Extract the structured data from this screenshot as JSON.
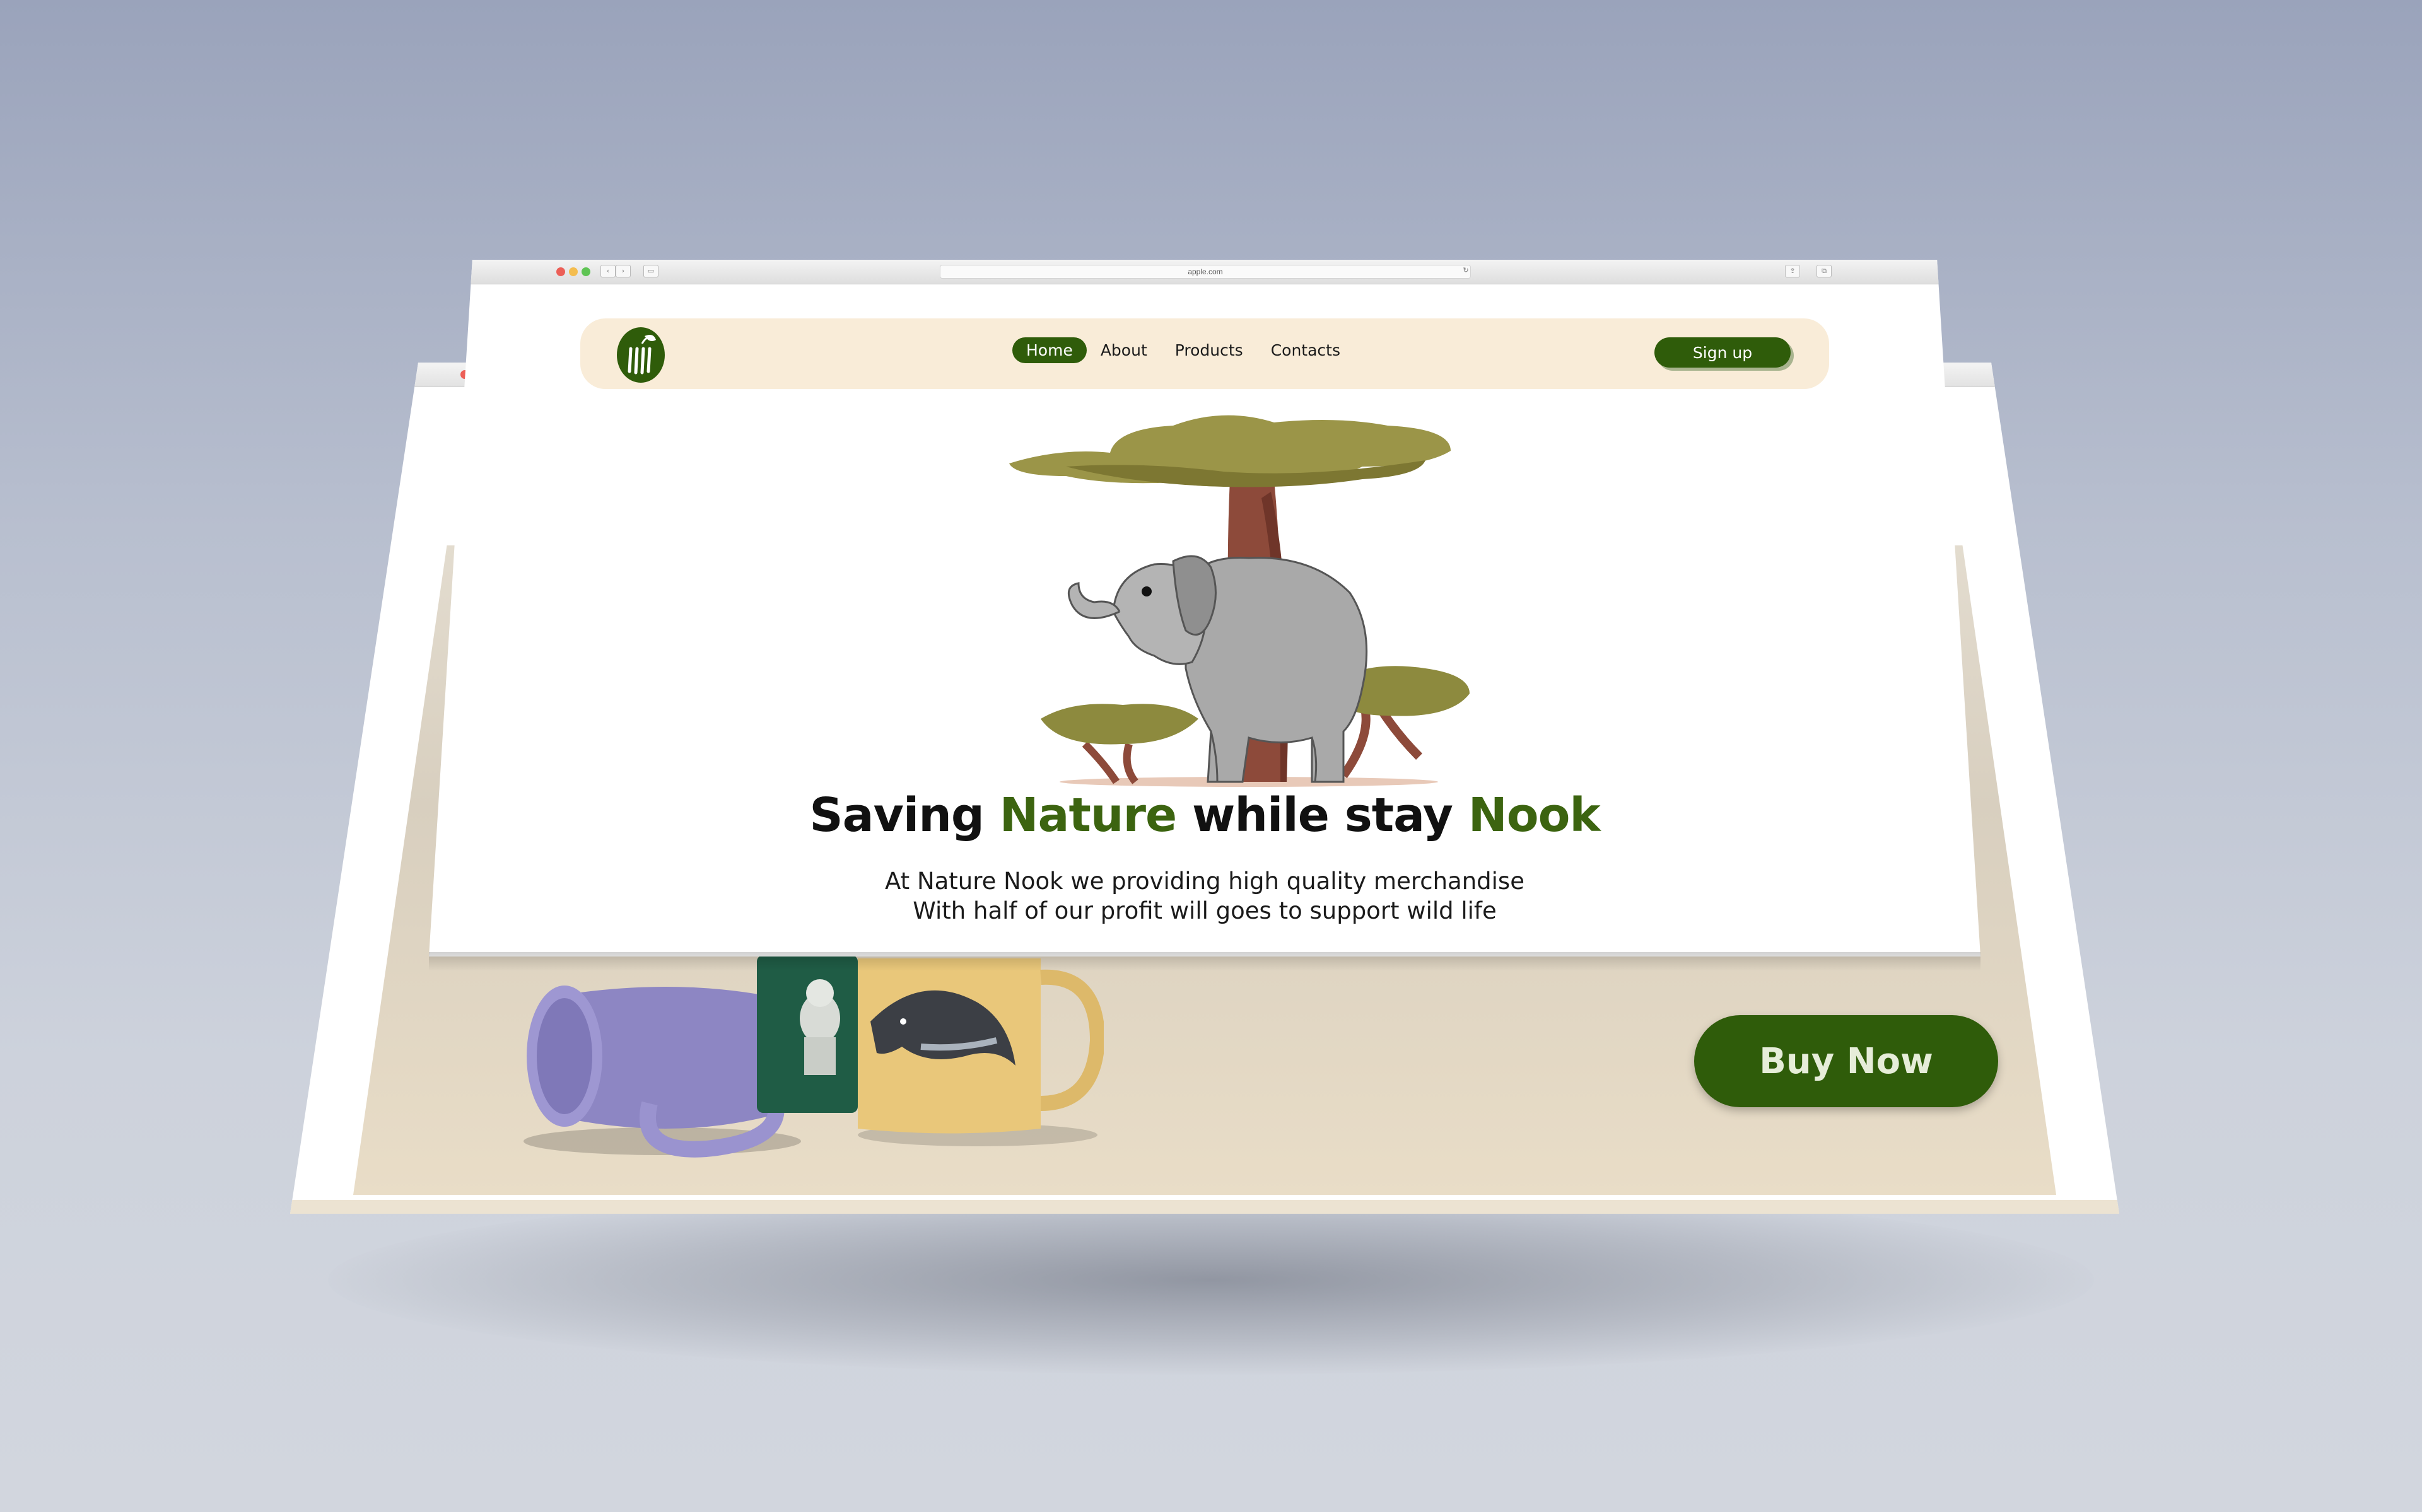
{
  "browser": {
    "url": "apple.com"
  },
  "nav": {
    "links": [
      "Home",
      "About",
      "Products",
      "Contacts"
    ],
    "active": "Home",
    "signup_label": "Sign up"
  },
  "hero": {
    "headline_parts": [
      "Saving ",
      "Nature",
      " while stay ",
      "Nook"
    ],
    "subtext_line1": "At Nature Nook we providing high quality merchandise",
    "subtext_line2": "With half of our profit will goes to support wild life"
  },
  "back_page": {
    "buy_label": "Buy Now"
  },
  "colors": {
    "brand_green": "#2f5c0a",
    "headline_green": "#3c6410",
    "nav_bg": "#f9ecd8",
    "panel_beige": "#e3dccf"
  },
  "icons": [
    "logo-leaf-icon",
    "back-arrow-icon",
    "forward-arrow-icon",
    "sidebar-icon",
    "reload-icon",
    "share-icon",
    "tabs-icon"
  ]
}
